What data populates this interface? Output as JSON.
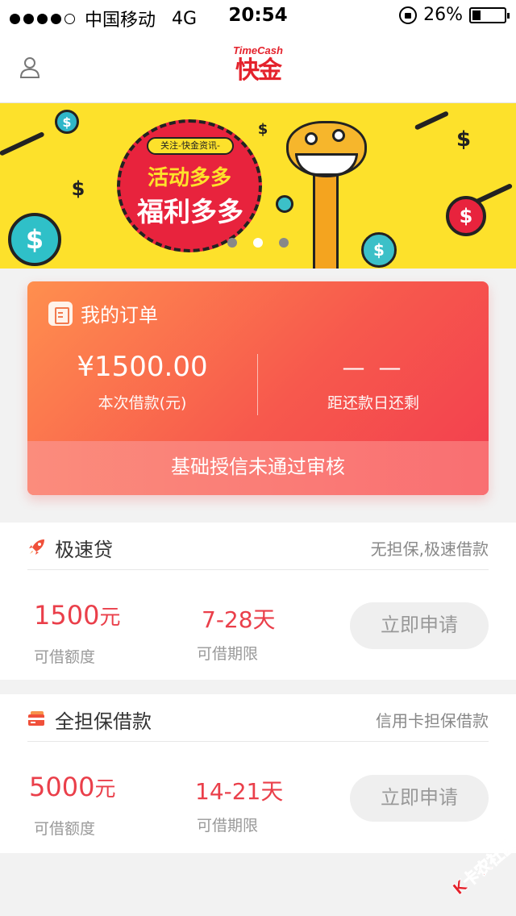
{
  "status_bar": {
    "carrier": "中国移动",
    "network": "4G",
    "time": "20:54",
    "battery": "26%",
    "battery_level": 0.26
  },
  "header": {
    "logo_en": "TimeCash",
    "logo_cn": "快金"
  },
  "banner": {
    "tag": "关注-快金资讯-",
    "line1": "活动多多",
    "line2": "福利多多",
    "active_slide": 1,
    "slide_count": 3
  },
  "order": {
    "title": "我的订单",
    "amount": "¥1500.00",
    "amount_label": "本次借款(元)",
    "days_value": "—  —",
    "days_label": "距还款日还剩",
    "status": "基础授信未通过审核"
  },
  "products": [
    {
      "name": "极速贷",
      "desc": "无担保,极速借款",
      "amount": "1500",
      "amount_unit": "元",
      "amount_label": "可借额度",
      "period": "7-28天",
      "period_label": "可借期限",
      "button": "立即申请",
      "icon": "rocket-icon"
    },
    {
      "name": "全担保借款",
      "desc": "信用卡担保借款",
      "amount": "5000",
      "amount_unit": "元",
      "amount_label": "可借额度",
      "period": "14-21天",
      "period_label": "可借期限",
      "button": "立即申请",
      "icon": "credit-card-icon"
    }
  ],
  "watermark": "卡农社区",
  "colors": {
    "brand": "#e4222c",
    "accent": "#ea3f4a",
    "banner_bg": "#fde12b",
    "card_start": "#ff8f4e",
    "card_end": "#f23d4e"
  }
}
